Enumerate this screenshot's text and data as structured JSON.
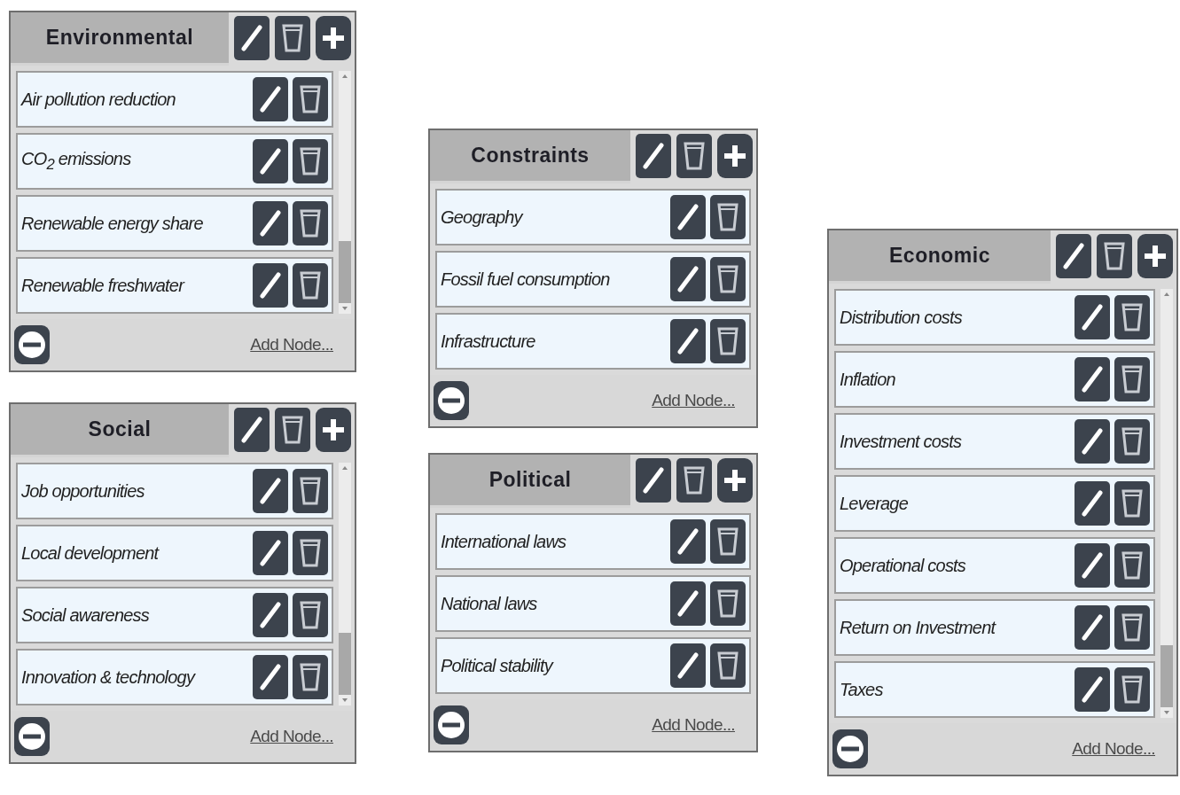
{
  "columns": [
    {
      "panels": [
        {
          "title": "Environmental",
          "scrollable": true,
          "items": [
            "Air pollution reduction",
            "CO$_{2}$ emissions",
            "Renewable energy share",
            "Renewable freshwater"
          ],
          "add_link": "Add Node..."
        },
        {
          "title": "Social",
          "scrollable": true,
          "items": [
            "Job opportunities",
            "Local development",
            "Social awareness",
            "Innovation & technology"
          ],
          "add_link": "Add Node..."
        }
      ]
    },
    {
      "panels": [
        {
          "title": "Constraints",
          "scrollable": false,
          "items": [
            "Geography",
            "Fossil fuel consumption",
            "Infrastructure"
          ],
          "add_link": "Add Node..."
        },
        {
          "title": "Political",
          "scrollable": false,
          "items": [
            "International laws",
            "National laws",
            "Political stability"
          ],
          "add_link": "Add Node..."
        }
      ]
    },
    {
      "panels": [
        {
          "title": "Economic",
          "scrollable": true,
          "items": [
            "Distribution costs",
            "Inflation",
            "Investment costs",
            "Leverage",
            "Operational costs",
            "Return on Investment",
            "Taxes"
          ],
          "add_link": "Add Node..."
        }
      ]
    }
  ]
}
